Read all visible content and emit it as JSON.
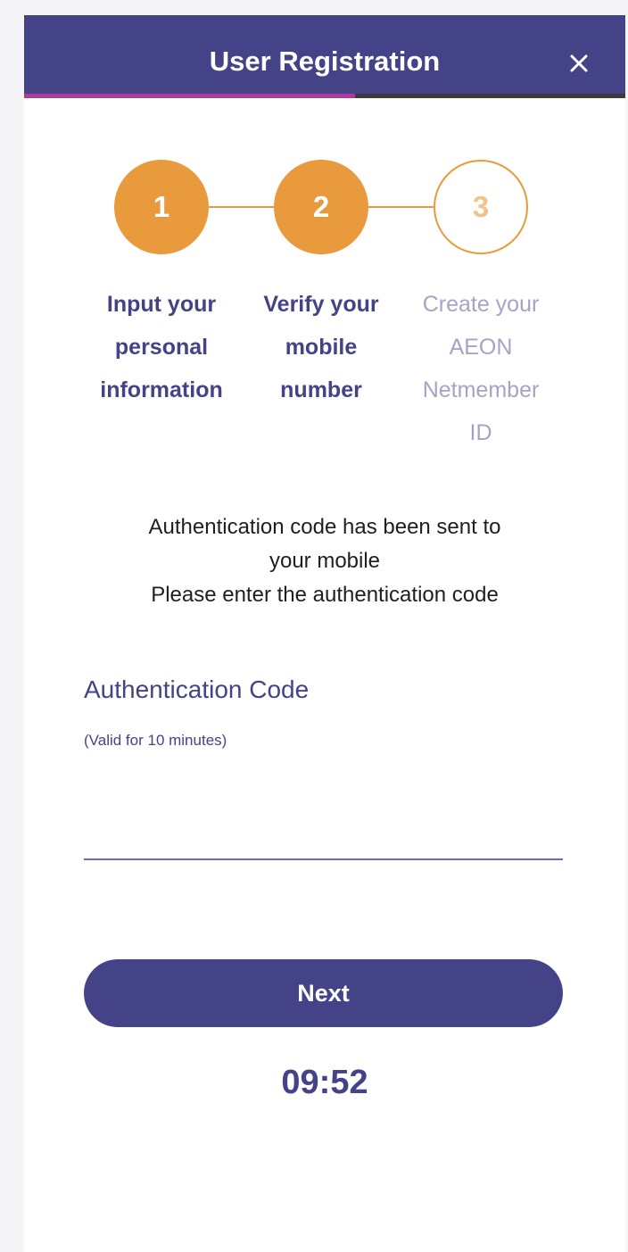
{
  "header": {
    "title": "User Registration",
    "close_icon": "close-icon",
    "progress": 0.55
  },
  "colors": {
    "primary": "#454387",
    "accent": "#e89a3c",
    "progress_fill": "#b0389a",
    "inactive_text": "#a5a4c8"
  },
  "stepper": {
    "steps": [
      {
        "number": "1",
        "lines": [
          "Input your",
          "personal",
          "information"
        ],
        "state": "done"
      },
      {
        "number": "2",
        "lines": [
          "Verify your",
          "mobile",
          "number"
        ],
        "state": "done"
      },
      {
        "number": "3",
        "lines": [
          "Create your",
          "AEON",
          "Netmember",
          "ID"
        ],
        "state": "todo"
      }
    ]
  },
  "message": {
    "line1": "Authentication code has been sent to",
    "line2": "your mobile",
    "line3": "Please enter the authentication code"
  },
  "form": {
    "label": "Authentication Code",
    "note": "(Valid for 10 minutes)",
    "value": "",
    "placeholder": ""
  },
  "actions": {
    "next_label": "Next"
  },
  "timer": {
    "remaining": "09:52"
  }
}
